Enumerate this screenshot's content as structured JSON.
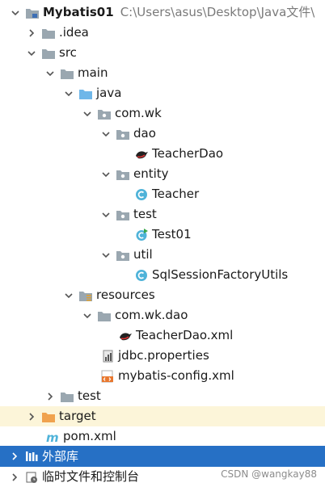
{
  "tree": {
    "project": {
      "name": "Mybatis01",
      "path": "C:\\Users\\asus\\Desktop\\Java文件\\"
    },
    "idea": ".idea",
    "src": "src",
    "main": "main",
    "java": "java",
    "pkg_comwk": "com.wk",
    "dao": "dao",
    "teacher_dao": "TeacherDao",
    "entity": "entity",
    "teacher": "Teacher",
    "test_pkg": "test",
    "test01": "Test01",
    "util": "util",
    "sql_util": "SqlSessionFactoryUtils",
    "resources": "resources",
    "res_pkg": "com.wk.dao",
    "teacher_dao_xml": "TeacherDao.xml",
    "jdbc_props": "jdbc.properties",
    "mybatis_config": "mybatis-config.xml",
    "test_dir": "test",
    "target": "target",
    "pom": "pom.xml",
    "external_libs": "外部库",
    "scratches": "临时文件和控制台"
  },
  "watermark": "CSDN @wangkay88",
  "colors": {
    "selection": "#2670c5",
    "target_bg": "#fcf5d9",
    "folder_gray": "#9aa7b0",
    "folder_blue": "#6fb7e9",
    "folder_orange": "#f0a24e",
    "class_teal": "#4fb3d9"
  }
}
